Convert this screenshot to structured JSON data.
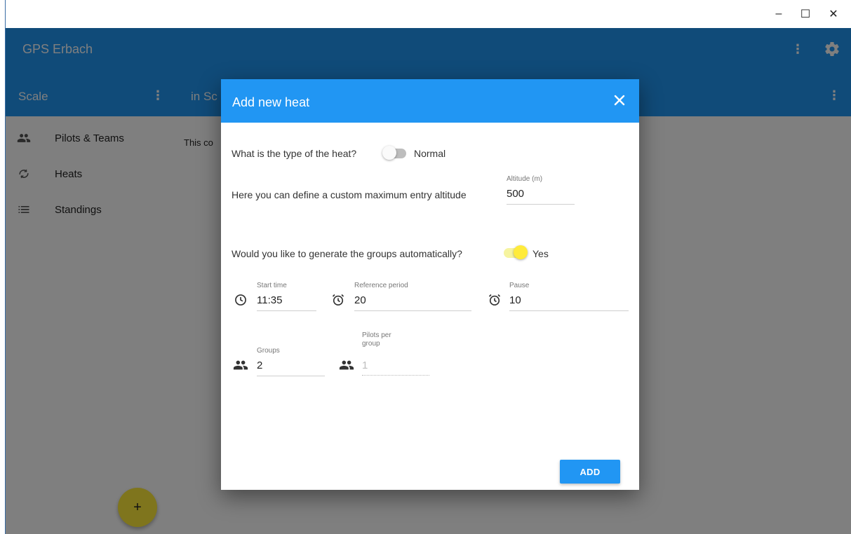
{
  "window": {
    "minimize": "–",
    "maximize": "☐",
    "close": "✕"
  },
  "app": {
    "title": "GPS Erbach",
    "more": "⋮"
  },
  "sidebar": {
    "title": "Scale",
    "more": "⋮",
    "items": [
      {
        "label": "Pilots & Teams",
        "icon": "people-icon"
      },
      {
        "label": "Heats",
        "icon": "refresh-icon"
      },
      {
        "label": "Standings",
        "icon": "list-icon"
      }
    ],
    "fab": "+"
  },
  "content": {
    "title": "in Sc",
    "more": "⋮",
    "text": "This co"
  },
  "dialog": {
    "title": "Add new heat",
    "type_question": "What is the type of the heat?",
    "type_value": "Normal",
    "altitude_text": "Here you can define a custom maximum entry altitude",
    "altitude_label": "Altitude (m)",
    "altitude_value": "500",
    "generate_question": "Would you like to generate the groups automatically?",
    "generate_value": "Yes",
    "start_time_label": "Start time",
    "start_time_value": "11:35",
    "reference_label": "Reference period",
    "reference_value": "20",
    "pause_label": "Pause",
    "pause_value": "10",
    "groups_label": "Groups",
    "groups_value": "2",
    "pilots_label": "Pilots per group",
    "pilots_value": "1",
    "add_label": "ADD"
  },
  "colors": {
    "primary": "#2196f3",
    "accent": "#ffeb3b"
  }
}
